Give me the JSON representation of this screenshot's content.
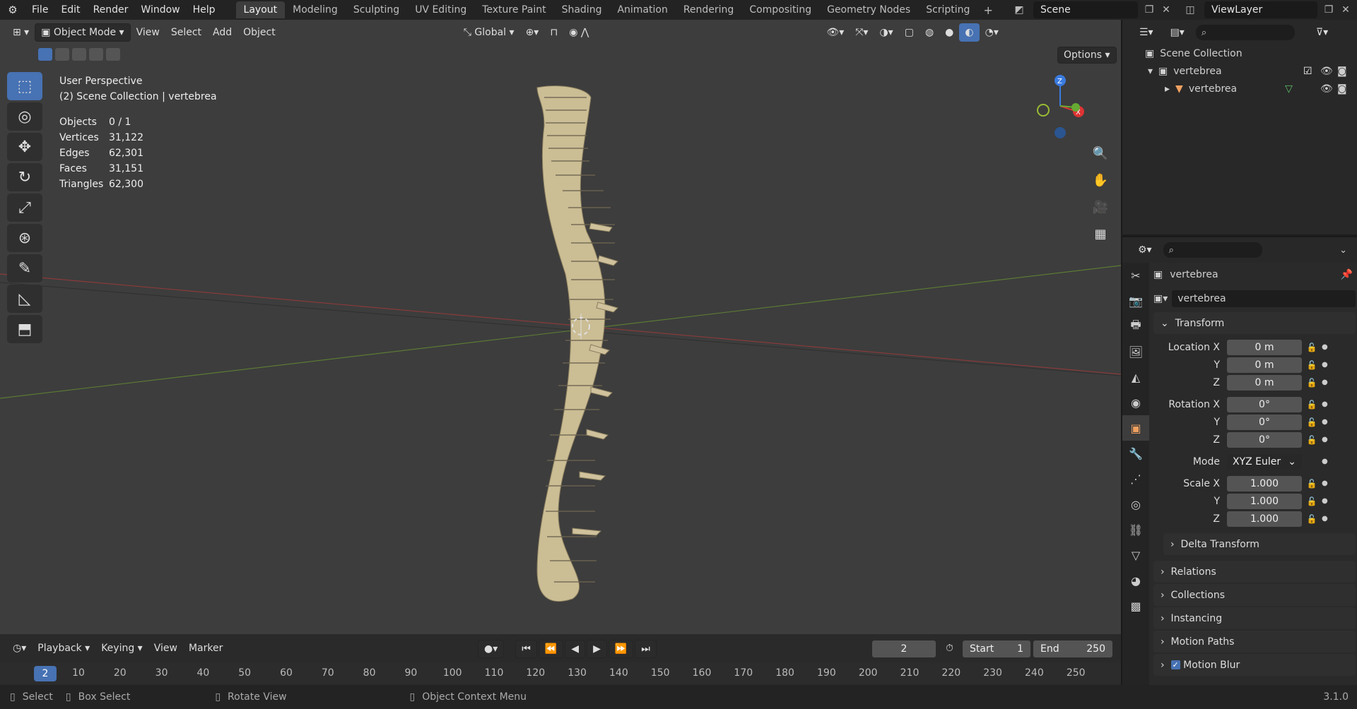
{
  "menu": [
    "File",
    "Edit",
    "Render",
    "Window",
    "Help"
  ],
  "workspaces": [
    "Layout",
    "Modeling",
    "Sculpting",
    "UV Editing",
    "Texture Paint",
    "Shading",
    "Animation",
    "Rendering",
    "Compositing",
    "Geometry Nodes",
    "Scripting"
  ],
  "scene_name": "Scene",
  "view_layer": "ViewLayer",
  "viewport_header": {
    "mode": "Object Mode",
    "view": "View",
    "select": "Select",
    "add": "Add",
    "object": "Object",
    "orientation": "Global",
    "options": "Options"
  },
  "overlay": {
    "perspective": "User Perspective",
    "collection": "(2) Scene Collection | vertebrea"
  },
  "stats": [
    {
      "k": "Objects",
      "v": "0 / 1"
    },
    {
      "k": "Vertices",
      "v": "31,122"
    },
    {
      "k": "Edges",
      "v": "62,301"
    },
    {
      "k": "Faces",
      "v": "31,151"
    },
    {
      "k": "Triangles",
      "v": "62,300"
    }
  ],
  "outliner": {
    "root": "Scene Collection",
    "collection": "vertebrea",
    "object": "vertebrea"
  },
  "properties": {
    "object_name": "vertebrea",
    "data_name": "vertebrea",
    "transform": "Transform",
    "location_label": "Location X",
    "loc_x": "0 m",
    "loc_y": "0 m",
    "loc_z": "0 m",
    "rotation_label": "Rotation X",
    "rot_x": "0°",
    "rot_y": "0°",
    "rot_z": "0°",
    "mode_label": "Mode",
    "mode_value": "XYZ Euler",
    "scale_label": "Scale X",
    "scale_x": "1.000",
    "scale_y": "1.000",
    "scale_z": "1.000",
    "y_label": "Y",
    "z_label": "Z",
    "delta": "Delta Transform",
    "relations": "Relations",
    "collections": "Collections",
    "instancing": "Instancing",
    "motion_paths": "Motion Paths",
    "motion_blur": "Motion Blur"
  },
  "timeline": {
    "playback": "Playback",
    "keying": "Keying",
    "view": "View",
    "marker": "Marker",
    "current": "2",
    "start_label": "Start",
    "start": "1",
    "end_label": "End",
    "end": "250",
    "ticks": [
      "10",
      "20",
      "30",
      "40",
      "50",
      "60",
      "70",
      "80",
      "90",
      "100",
      "110",
      "120",
      "130",
      "140",
      "150",
      "160",
      "170",
      "180",
      "190",
      "200",
      "210",
      "220",
      "230",
      "240",
      "250"
    ],
    "cur_tick": "2"
  },
  "status": {
    "select": "Select",
    "box_select": "Box Select",
    "rotate_view": "Rotate View",
    "context_menu": "Object Context Menu",
    "version": "3.1.0"
  }
}
